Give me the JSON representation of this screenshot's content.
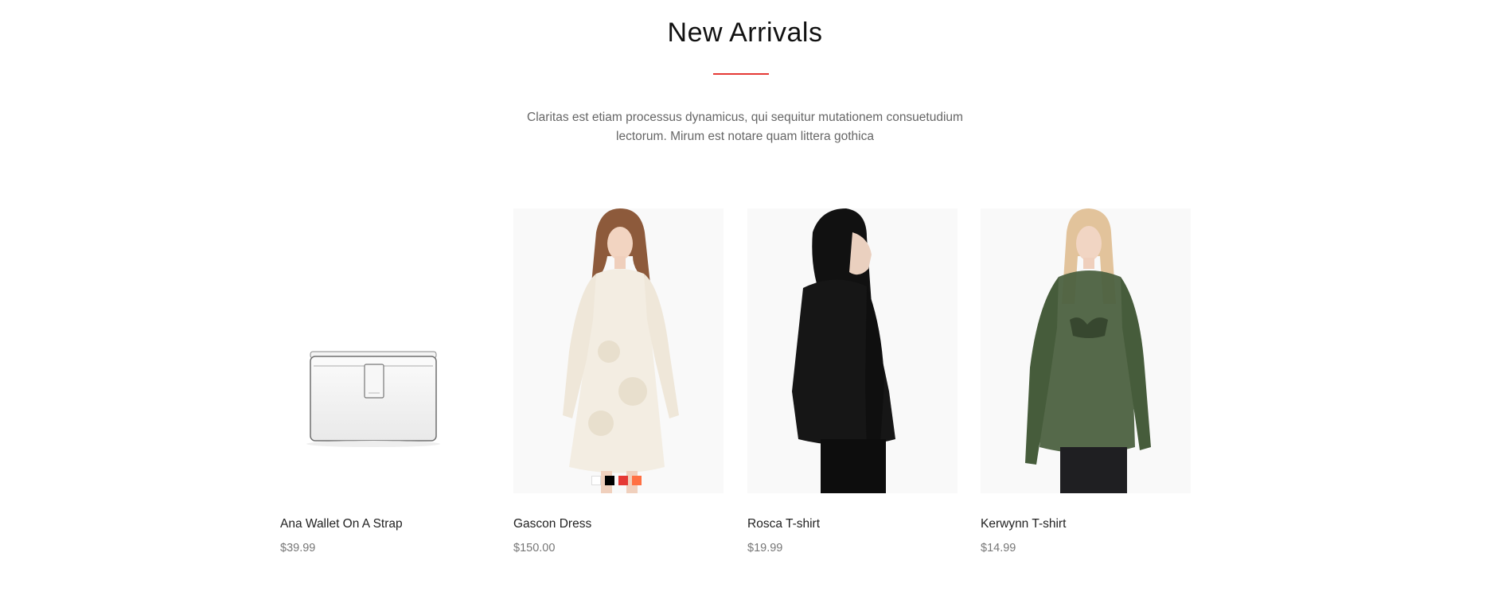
{
  "section": {
    "title": "New Arrivals",
    "description": "Claritas est etiam processus dynamicus, qui sequitur mutationem consuetudium lectorum. Mirum est notare quam littera gothica",
    "accent_color": "#e53935"
  },
  "products": [
    {
      "name": "Ana Wallet On A Strap",
      "price": "$39.99",
      "image": "white-leather-wallet-bag"
    },
    {
      "name": "Gascon Dress",
      "price": "$150.00",
      "image": "cream-floral-dress-model",
      "swatches": [
        "#ffffff",
        "#000000",
        "#e53935",
        "#ff7043"
      ]
    },
    {
      "name": "Rosca T-shirt",
      "price": "$19.99",
      "image": "black-top-model"
    },
    {
      "name": "Kerwynn T-shirt",
      "price": "$14.99",
      "image": "green-sheer-blouse-model"
    }
  ]
}
